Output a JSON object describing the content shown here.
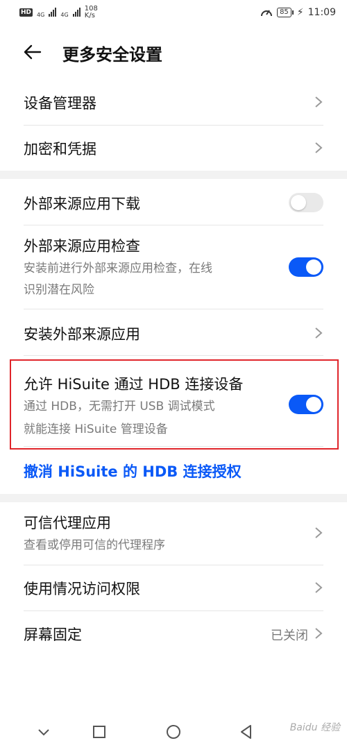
{
  "status_bar": {
    "hd_badge": "HD",
    "signal1": "4G",
    "signal2": "4G",
    "speed_value": "108",
    "speed_unit": "K/s",
    "battery": "85",
    "time": "11:09"
  },
  "header": {
    "title": "更多安全设置"
  },
  "items": {
    "device_manager": "设备管理器",
    "encryption": "加密和凭据",
    "external_download": {
      "label": "外部来源应用下载",
      "enabled": false
    },
    "external_check": {
      "label": "外部来源应用检查",
      "desc_line1": "安装前进行外部来源应用检查，在线",
      "desc_line2": "识别潜在风险",
      "enabled": true
    },
    "install_external": "安装外部来源应用",
    "hisuite": {
      "label": "允许 HiSuite 通过 HDB 连接设备",
      "desc_line1": "通过 HDB，无需打开 USB 调试模式",
      "desc_line2": "就能连接 HiSuite 管理设备",
      "enabled": true
    },
    "revoke_link": "撤消 HiSuite 的 HDB 连接授权",
    "trust_agents": {
      "label": "可信代理应用",
      "desc": "查看或停用可信的代理程序"
    },
    "usage_access": "使用情况访问权限",
    "screen_pinning": {
      "label": "屏幕固定",
      "value": "已关闭"
    }
  },
  "watermark": "Baidu 经验",
  "colors": {
    "accent": "#0a59f7",
    "highlight": "#e0242a"
  }
}
